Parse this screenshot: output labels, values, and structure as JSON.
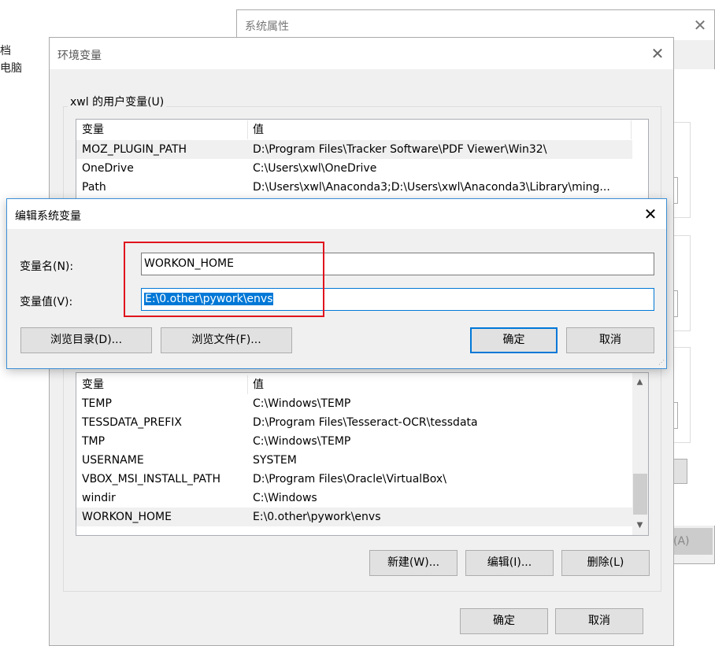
{
  "desktop": {
    "fragment_line1": "档",
    "fragment_line2": "电脑"
  },
  "system_properties": {
    "title": "系统属性",
    "apply_fragment": "(A)"
  },
  "env_vars": {
    "title": "环境变量",
    "user_group_label": "xwl 的用户变量(U)",
    "col_name": "变量",
    "col_value": "值",
    "user_rows": [
      {
        "name": "MOZ_PLUGIN_PATH",
        "value": "D:\\Program Files\\Tracker Software\\PDF Viewer\\Win32\\"
      },
      {
        "name": "OneDrive",
        "value": "C:\\Users\\xwl\\OneDrive"
      },
      {
        "name": "Path",
        "value": "D:\\Users\\xwl\\Anaconda3;D:\\Users\\xwl\\Anaconda3\\Library\\ming..."
      }
    ],
    "system_rows": [
      {
        "name": "TEMP",
        "value": "C:\\Windows\\TEMP"
      },
      {
        "name": "TESSDATA_PREFIX",
        "value": "D:\\Program Files\\Tesseract-OCR\\tessdata"
      },
      {
        "name": "TMP",
        "value": "C:\\Windows\\TEMP"
      },
      {
        "name": "USERNAME",
        "value": "SYSTEM"
      },
      {
        "name": "VBOX_MSI_INSTALL_PATH",
        "value": "D:\\Program Files\\Oracle\\VirtualBox\\"
      },
      {
        "name": "windir",
        "value": "C:\\Windows"
      },
      {
        "name": "WORKON_HOME",
        "value": "E:\\0.other\\pywork\\envs"
      }
    ],
    "new_button": "新建(W)...",
    "edit_button": "编辑(I)...",
    "delete_button": "删除(L)",
    "ok_button": "确定",
    "cancel_button": "取消"
  },
  "edit_dialog": {
    "title": "编辑系统变量",
    "name_label": "变量名(N):",
    "value_label": "变量值(V):",
    "name_value": "WORKON_HOME",
    "value_value": "E:\\0.other\\pywork\\envs",
    "browse_dir_button": "浏览目录(D)...",
    "browse_file_button": "浏览文件(F)...",
    "ok_button": "确定",
    "cancel_button": "取消"
  },
  "colors": {
    "accent": "#0078d7",
    "highlight_box": "#e0141e"
  }
}
